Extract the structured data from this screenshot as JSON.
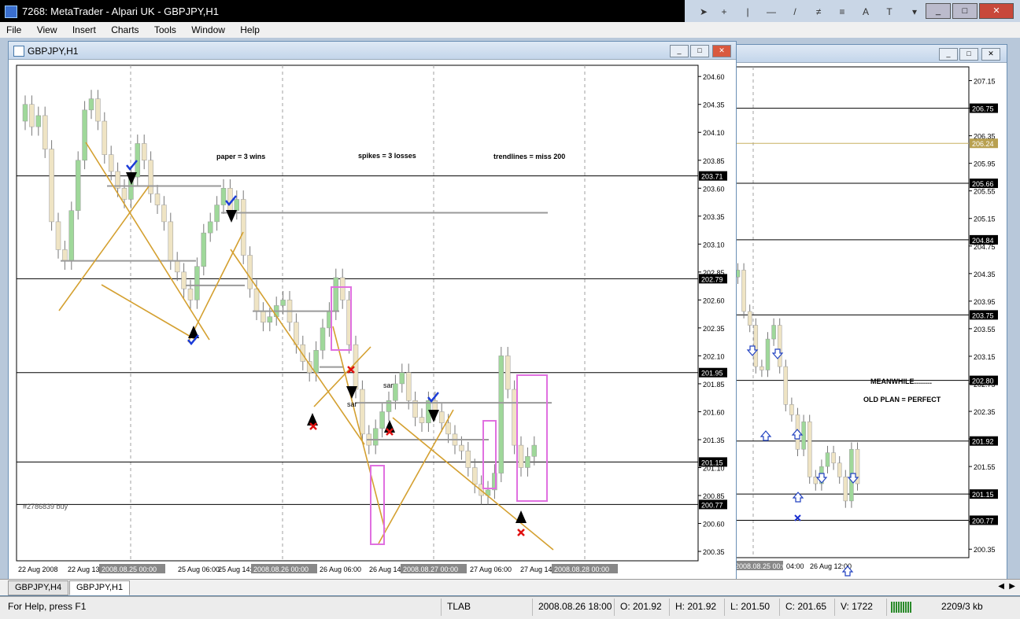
{
  "app": {
    "title": "7268: MetaTrader - Alpari UK - GBPJPY,H1"
  },
  "menu": [
    "File",
    "View",
    "Insert",
    "Charts",
    "Tools",
    "Window",
    "Help"
  ],
  "toolbar_icons": [
    "cursor-icon",
    "crosshair-icon",
    "vertical-line-icon",
    "horizontal-line-icon",
    "trendline-icon",
    "equidistant-channel-icon",
    "fibonacci-icon",
    "text-icon",
    "text-label-icon"
  ],
  "window_buttons": [
    "_",
    "□",
    "✕"
  ],
  "main_chart": {
    "title": "GBPJPY,H1",
    "price_ticks": [
      "204.60",
      "204.35",
      "204.10",
      "203.85",
      "203.60",
      "203.35",
      "203.10",
      "202.85",
      "202.60",
      "202.35",
      "202.10",
      "201.85",
      "201.60",
      "201.35",
      "201.10",
      "200.85",
      "200.60",
      "200.35"
    ],
    "level_labels": [
      "203.71",
      "202.79",
      "201.95",
      "201.15",
      "200.77"
    ],
    "time_labels": [
      "22 Aug 2008",
      "22 Aug 13:00",
      "25 Aug 06:00",
      "25 Aug 14:00",
      "26 Aug 06:00",
      "26 Aug 14:00",
      "27 Aug 06:00",
      "27 Aug 14:00"
    ],
    "date_tags": [
      "2008.08.25 00:00",
      "2008.08.26 00:00",
      "2008.08.27 00:00",
      "2008.08.28 00:00"
    ],
    "annotations": {
      "paper": "paper = 3 wins",
      "spikes": "spikes = 3 losses",
      "trendlines": "trendlines = miss 200"
    },
    "sar_labels": [
      "sar",
      "sar"
    ],
    "order_label": "#2786839 buy"
  },
  "side_chart": {
    "price_ticks": [
      "207.15",
      "206.75",
      "206.35",
      "205.95",
      "205.55",
      "205.15",
      "204.75",
      "204.35",
      "203.95",
      "203.55",
      "203.15",
      "202.75",
      "202.35",
      "201.95",
      "201.55",
      "201.15",
      "200.75",
      "200.35"
    ],
    "level_labels": [
      "206.75",
      "206.24",
      "205.66",
      "204.84",
      "203.75",
      "202.80",
      "201.92",
      "201.15",
      "200.77"
    ],
    "time_labels": [
      "04:00",
      "26 Aug 12:00"
    ],
    "date_tags": [
      "2008.08.25 00:00"
    ],
    "notes": {
      "meanwhile": "MEANWHILE.........",
      "old_plan": "OLD PLAN = PERFECT"
    }
  },
  "tabs": [
    "GBPJPY,H4",
    "GBPJPY,H1"
  ],
  "status": {
    "help": "For Help, press F1",
    "profile": "TLAB",
    "time": "2008.08.26 18:00",
    "open": "O: 201.92",
    "high": "H: 201.92",
    "low": "L: 201.50",
    "close": "C: 201.65",
    "volume": "V: 1722",
    "traffic": "2209/3 kb"
  },
  "colors": {
    "bull": "#9fd89a",
    "bear": "#efe4c4",
    "trend": "#d4a030",
    "grid": "#a0a0a0",
    "box": "#e070e0",
    "check": "#1a3bd8",
    "cross": "#e01010"
  }
}
